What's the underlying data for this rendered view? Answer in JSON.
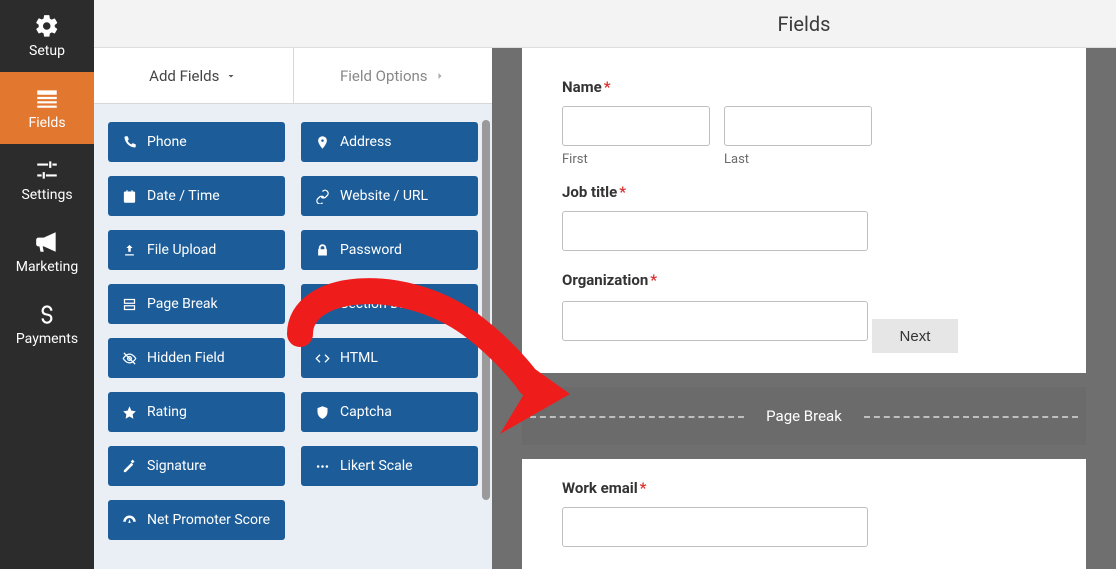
{
  "nav": {
    "items": [
      {
        "label": "Setup"
      },
      {
        "label": "Fields"
      },
      {
        "label": "Settings"
      },
      {
        "label": "Marketing"
      },
      {
        "label": "Payments"
      }
    ]
  },
  "builder": {
    "tabs": {
      "add_fields": "Add Fields",
      "field_options": "Field Options"
    },
    "field_buttons": [
      "Phone",
      "Address",
      "Date / Time",
      "Website / URL",
      "File Upload",
      "Password",
      "Page Break",
      "Section Divider",
      "Hidden Field",
      "HTML",
      "Rating",
      "Captcha",
      "Signature",
      "Likert Scale",
      "Net Promoter Score"
    ]
  },
  "preview": {
    "header": "Fields",
    "name_label": "Name",
    "first_sub": "First",
    "last_sub": "Last",
    "job_title_label": "Job title",
    "organization_label": "Organization",
    "next_button": "Next",
    "page_break_label": "Page Break",
    "work_email_label": "Work email"
  }
}
